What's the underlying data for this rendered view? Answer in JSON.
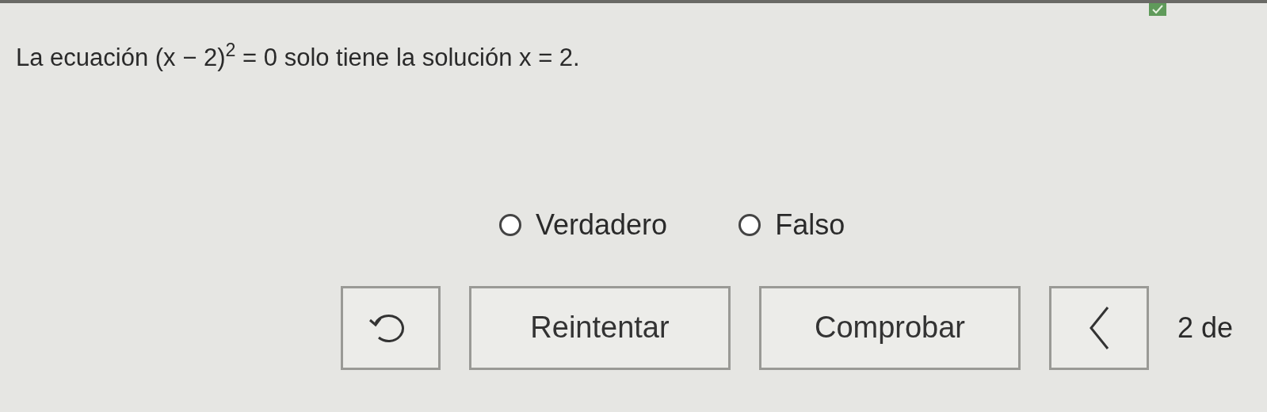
{
  "question": "La ecuación (x − 2)$^{2}$ = 0 solo tiene la solución x = 2.",
  "options": [
    {
      "label": "Verdadero",
      "selected": false
    },
    {
      "label": "Falso",
      "selected": false
    }
  ],
  "actions": [
    {
      "kind": "retry-icon"
    },
    {
      "kind": "text",
      "label": "Reintentar"
    },
    {
      "kind": "text",
      "label": "Comprobar"
    },
    {
      "kind": "back-icon"
    }
  ],
  "pager": "2 de"
}
